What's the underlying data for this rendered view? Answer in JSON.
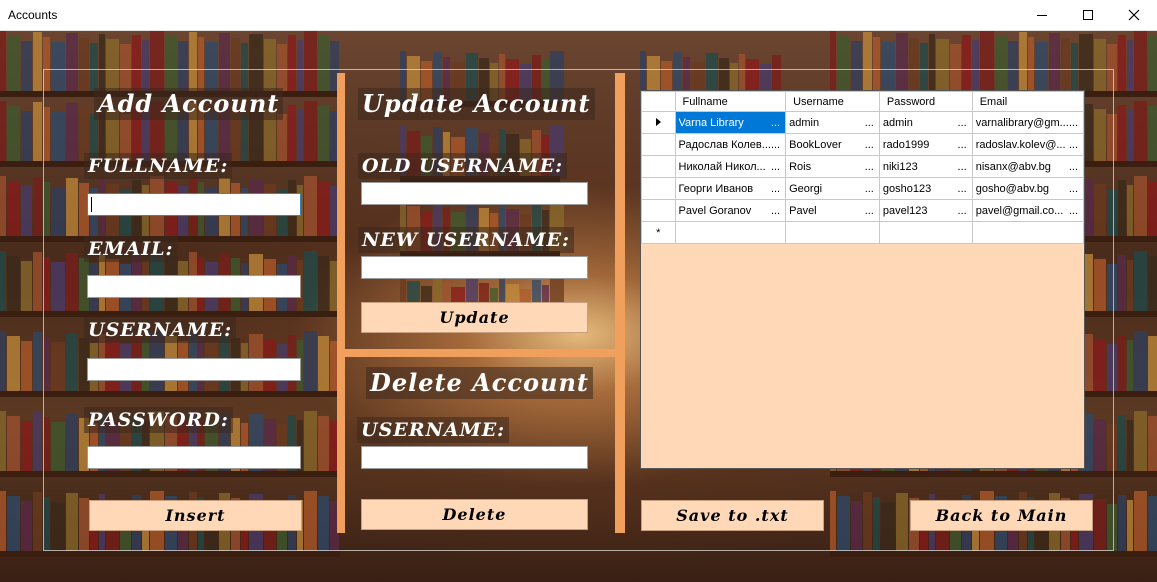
{
  "window": {
    "title": "Accounts"
  },
  "add_account": {
    "heading": "Add Account",
    "fullname_label": "FULLNAME:",
    "email_label": "EMAIL:",
    "username_label": "USERNAME:",
    "password_label": "PASSWORD:",
    "fullname_value": "",
    "email_value": "",
    "username_value": "",
    "password_value": "",
    "insert_button": "Insert"
  },
  "update_account": {
    "heading": "Update Account",
    "old_username_label": "OLD USERNAME:",
    "new_username_label": "NEW USERNAME:",
    "update_button": "Update"
  },
  "delete_account": {
    "heading": "Delete Account",
    "username_label": "USERNAME:",
    "delete_button": "Delete"
  },
  "grid": {
    "columns": [
      "Fullname",
      "Username",
      "Password",
      "Email"
    ],
    "rows": [
      [
        "Varna Library",
        "admin",
        "admin",
        "varnalibrary@gm..."
      ],
      [
        "Радослав Колев...",
        "BookLover",
        "rado1999",
        "radoslav.kolev@..."
      ],
      [
        "Николай Никол...",
        "Rois",
        "niki123",
        "nisanx@abv.bg"
      ],
      [
        "Георги Иванов",
        "Georgi",
        "gosho123",
        "gosho@abv.bg"
      ],
      [
        "Pavel Goranov",
        "Pavel",
        "pavel123",
        "pavel@gmail.co..."
      ]
    ],
    "new_row_marker": "*",
    "ellipsis": "..."
  },
  "buttons": {
    "save": "Save to .txt",
    "back": "Back to Main"
  },
  "colors": {
    "accent": "#f0a05c",
    "button_bg": "#ffd8b8",
    "selection": "#0078d7"
  }
}
